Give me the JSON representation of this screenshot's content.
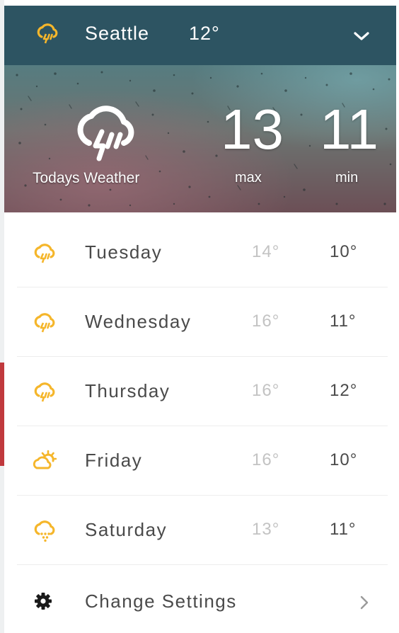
{
  "colors": {
    "header_bg": "#2d5462",
    "icon_yellow": "#f5b62b",
    "text_dark": "#4a4a4a",
    "text_muted": "#c3c3c3"
  },
  "header": {
    "city": "Seattle",
    "temp": "12°",
    "icon": "rain-cloud-icon",
    "toggle_icon": "chevron-down-icon"
  },
  "today": {
    "label": "Todays Weather",
    "max": "13",
    "min": "11",
    "max_label": "max",
    "min_label": "min",
    "icon": "rain-cloud-icon"
  },
  "forecast": [
    {
      "day": "Tuesday",
      "max": "14°",
      "min": "10°",
      "icon": "rain-cloud-icon"
    },
    {
      "day": "Wednesday",
      "max": "16°",
      "min": "11°",
      "icon": "rain-cloud-icon"
    },
    {
      "day": "Thursday",
      "max": "16°",
      "min": "12°",
      "icon": "rain-cloud-icon"
    },
    {
      "day": "Friday",
      "max": "16°",
      "min": "10°",
      "icon": "partly-sunny-icon"
    },
    {
      "day": "Saturday",
      "max": "13°",
      "min": "11°",
      "icon": "drizzle-cloud-icon"
    }
  ],
  "settings": {
    "label": "Change Settings",
    "icon": "gear-icon",
    "arrow_icon": "chevron-right-icon"
  }
}
